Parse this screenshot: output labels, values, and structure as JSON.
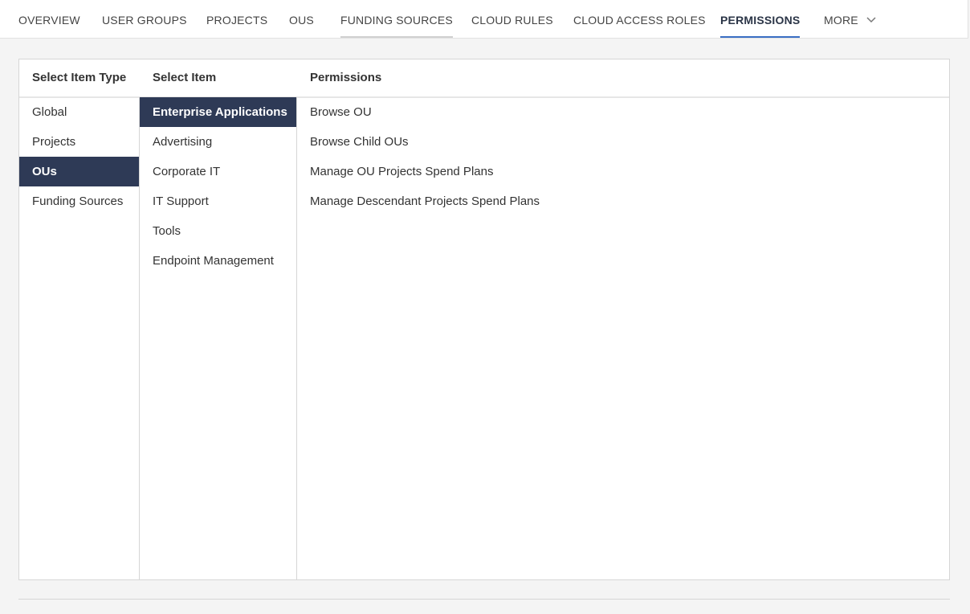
{
  "tabs": [
    {
      "label": "OVERVIEW"
    },
    {
      "label": "USER GROUPS"
    },
    {
      "label": "PROJECTS"
    },
    {
      "label": "OUS"
    },
    {
      "label": "FUNDING SOURCES"
    },
    {
      "label": "CLOUD RULES"
    },
    {
      "label": "CLOUD ACCESS ROLES"
    },
    {
      "label": "PERMISSIONS",
      "active": true
    },
    {
      "label": "MORE"
    }
  ],
  "panel": {
    "headers": {
      "item_type": "Select Item Type",
      "item": "Select Item",
      "permissions": "Permissions"
    },
    "item_types": [
      "Global",
      "Projects",
      "OUs",
      "Funding Sources"
    ],
    "selected_item_type": "OUs",
    "items": [
      "Enterprise Applications",
      "Advertising",
      "Corporate IT",
      "IT Support",
      "Tools",
      "Endpoint Management"
    ],
    "selected_item": "Enterprise Applications",
    "permissions": [
      "Browse OU",
      "Browse Child OUs",
      "Manage OU Projects Spend Plans",
      "Manage Descendant Projects Spend Plans"
    ]
  },
  "colors": {
    "selected_bg": "#2e3a56",
    "active_tab_underline": "#3a6fc4"
  }
}
